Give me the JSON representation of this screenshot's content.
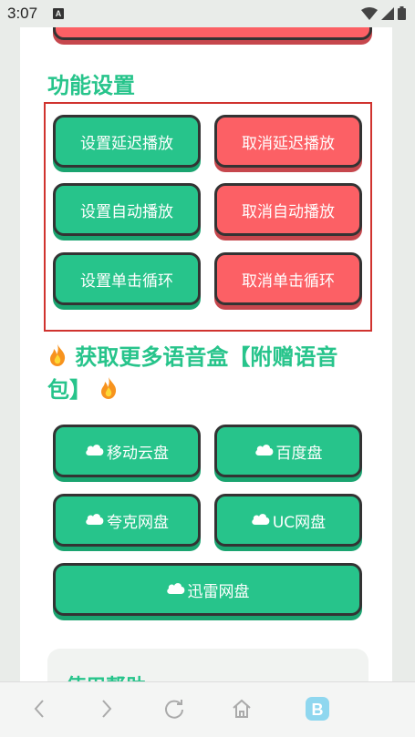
{
  "status_bar": {
    "time": "3:07",
    "notif_letter": "A"
  },
  "sections": {
    "settings_title": "功能设置",
    "more_title_line1": "获取更多语音盒【附赠语音",
    "more_title_line2": "包】",
    "help_title": "使用帮助"
  },
  "settings_buttons": {
    "set_delay": "设置延迟播放",
    "cancel_delay": "取消延迟播放",
    "set_auto": "设置自动播放",
    "cancel_auto": "取消自动播放",
    "set_loop": "设置单击循环",
    "cancel_loop": "取消单击循环"
  },
  "drive_buttons": {
    "mobile_cloud": "移动云盘",
    "baidu": "百度盘",
    "quark": "夸克网盘",
    "uc": "UC网盘",
    "xunlei": "迅雷网盘"
  },
  "colors": {
    "green": "#27c48b",
    "red": "#fc6065",
    "highlight_border": "#d0332f"
  },
  "icons": [
    "fire-icon",
    "cloud-icon",
    "back-icon",
    "forward-icon",
    "refresh-icon",
    "home-icon",
    "browser-logo-icon"
  ]
}
